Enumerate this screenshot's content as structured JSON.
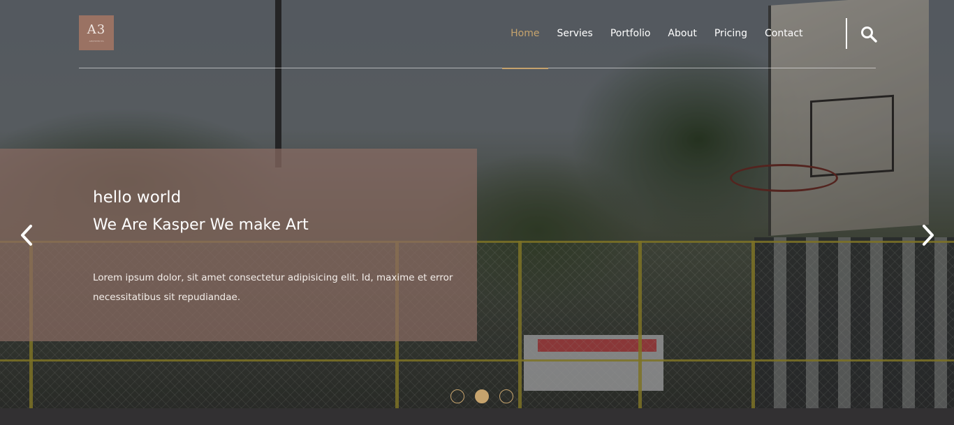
{
  "brand": {
    "logo_text": "A3",
    "logo_subtext": "ARCHITECTS",
    "color": "#9a7263"
  },
  "nav": {
    "items": [
      {
        "label": "Home",
        "active": true
      },
      {
        "label": "Servies",
        "active": false
      },
      {
        "label": "Portfolio",
        "active": false
      },
      {
        "label": "About",
        "active": false
      },
      {
        "label": "Pricing",
        "active": false
      },
      {
        "label": "Contact",
        "active": false
      }
    ],
    "search_icon": "search-icon",
    "accent_color": "#c6a36d"
  },
  "slide": {
    "title": "hello world",
    "subtitle": "We Are Kasper We make Art",
    "text": "Lorem ipsum dolor, sit amet consectetur adipisicing elit. Id, maxime et error necessitatibus sit repudiandae.",
    "box_color": "#896b63"
  },
  "carousel": {
    "prev_icon": "chevron-left-icon",
    "next_icon": "chevron-right-icon",
    "dots": [
      {
        "active": false
      },
      {
        "active": true
      },
      {
        "active": false
      }
    ]
  }
}
